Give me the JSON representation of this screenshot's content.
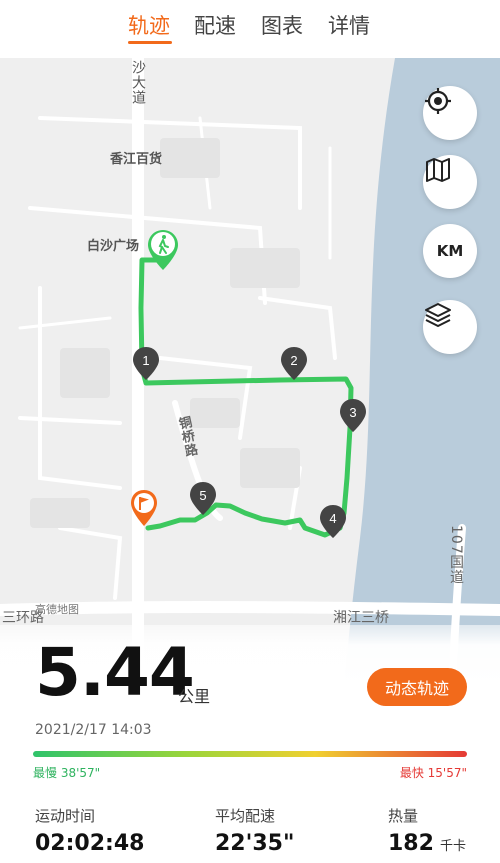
{
  "tabs": [
    {
      "label": "轨迹",
      "active": true
    },
    {
      "label": "配速",
      "active": false
    },
    {
      "label": "图表",
      "active": false
    },
    {
      "label": "详情",
      "active": false
    }
  ],
  "map": {
    "labels": {
      "road_shadadao": "沙大道",
      "poi_xiangjiang": "香江百货",
      "poi_baisha": "白沙广场",
      "road_tongqiao": "铜桥路",
      "road_107": "107国道",
      "road_sanhuan": "三环路",
      "road_xiangjiang_bridge": "湘江三桥",
      "attribution": "高德地图"
    },
    "km_markers": [
      "1",
      "2",
      "3",
      "4",
      "5"
    ],
    "controls": {
      "units_label": "KM"
    },
    "colors": {
      "route": "#3cc85e",
      "river": "#b9ccdb",
      "accent": "#f26a1b"
    }
  },
  "summary": {
    "distance": "5.44",
    "distance_unit": "公里",
    "replay_button": "动态轨迹",
    "datetime": "2021/2/17 14:03",
    "pace_slowest": "最慢 38'57\"",
    "pace_fastest": "最快 15'57\""
  },
  "stats": [
    {
      "label": "运动时间",
      "value": "02:02:48",
      "unit": ""
    },
    {
      "label": "平均配速",
      "value": "22'35\"",
      "unit": ""
    },
    {
      "label": "热量",
      "value": "182",
      "unit": "千卡"
    }
  ]
}
